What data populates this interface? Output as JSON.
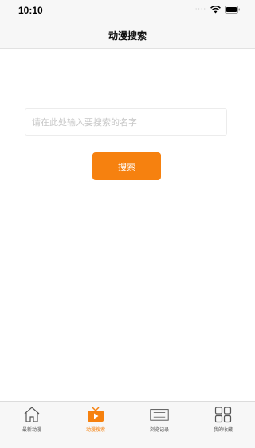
{
  "status_bar": {
    "time": "10:10",
    "signal": "····"
  },
  "nav": {
    "title": "动漫搜索"
  },
  "search": {
    "placeholder": "请在此处输入要搜索的名字",
    "value": "",
    "button_label": "搜索"
  },
  "tabs": [
    {
      "label": "最新动漫",
      "icon": "home-icon",
      "active": false
    },
    {
      "label": "动漫搜索",
      "icon": "tv-play-icon",
      "active": true
    },
    {
      "label": "浏览记录",
      "icon": "list-icon",
      "active": false
    },
    {
      "label": "我的收藏",
      "icon": "grid-icon",
      "active": false
    }
  ],
  "colors": {
    "accent": "#f6810f",
    "inactive": "#555555",
    "bar_bg": "#f7f7f7"
  }
}
